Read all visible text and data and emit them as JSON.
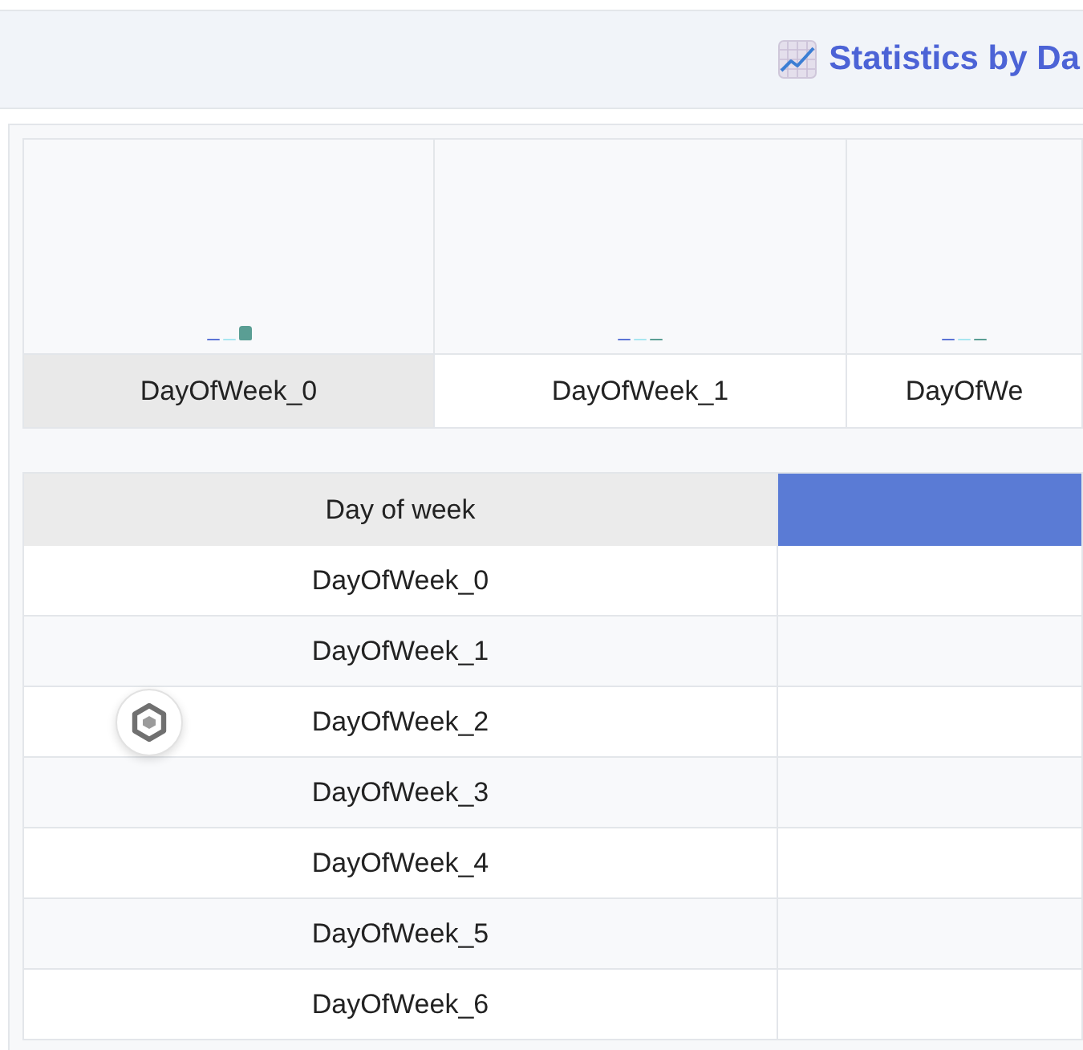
{
  "header": {
    "title": "Statistics by Da"
  },
  "chart": {
    "groups": [
      {
        "label": "DayOfWeek_0",
        "selected": true
      },
      {
        "label": "DayOfWeek_1",
        "selected": false
      },
      {
        "label": "DayOfWe",
        "selected": false
      }
    ]
  },
  "table": {
    "columns": [
      {
        "label": "Day of week",
        "kind": "key"
      },
      {
        "kind": "series",
        "color": "#5a7bd5"
      }
    ],
    "rows": [
      [
        "DayOfWeek_0"
      ],
      [
        "DayOfWeek_1"
      ],
      [
        "DayOfWeek_2"
      ],
      [
        "DayOfWeek_3"
      ],
      [
        "DayOfWeek_4"
      ],
      [
        "DayOfWeek_5"
      ],
      [
        "DayOfWeek_6"
      ]
    ]
  }
}
